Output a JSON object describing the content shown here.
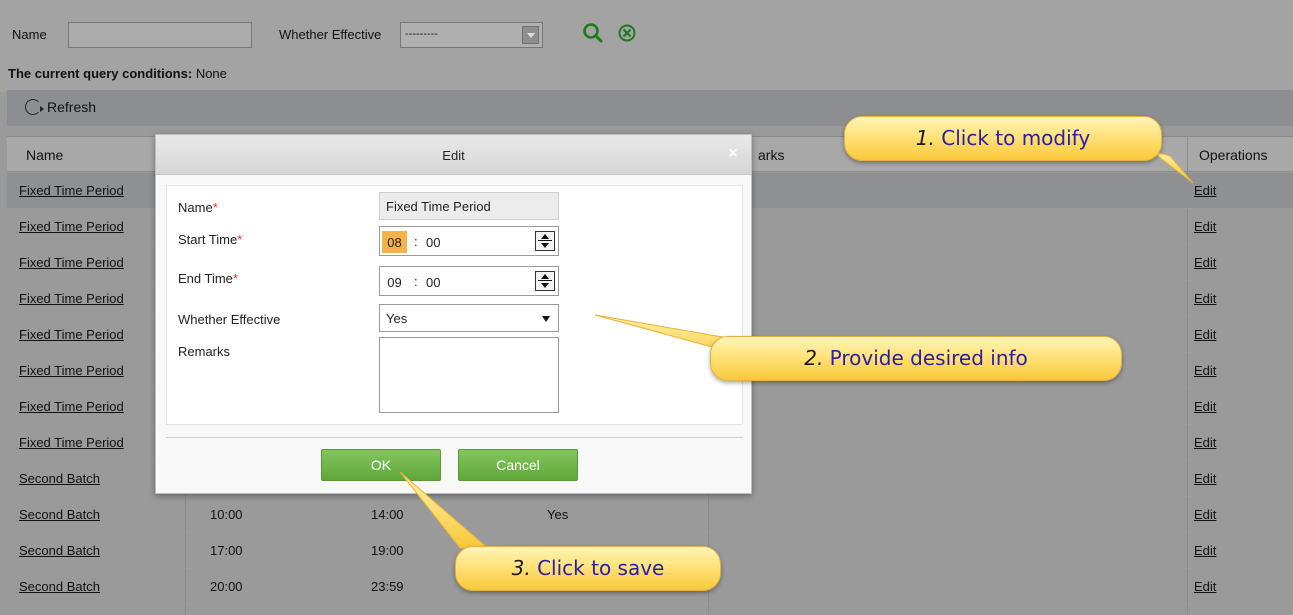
{
  "filter": {
    "name_label": "Name",
    "name_value": "",
    "effective_label": "Whether Effective",
    "effective_value": "---------",
    "query_prefix": "The current query conditions:",
    "query_value": "None"
  },
  "toolbar": {
    "refresh_label": "Refresh"
  },
  "table": {
    "headers": [
      "Name",
      "",
      "",
      "arks",
      "Operations"
    ],
    "rows": [
      {
        "name": "Fixed Time Period",
        "start": "",
        "end": "",
        "effective": "",
        "op": "Edit"
      },
      {
        "name": "Fixed Time Period",
        "start": "",
        "end": "",
        "effective": "",
        "op": "Edit"
      },
      {
        "name": "Fixed Time Period",
        "start": "",
        "end": "",
        "effective": "",
        "op": "Edit"
      },
      {
        "name": "Fixed Time Period",
        "start": "",
        "end": "",
        "effective": "",
        "op": "Edit"
      },
      {
        "name": "Fixed Time Period",
        "start": "",
        "end": "",
        "effective": "",
        "op": "Edit"
      },
      {
        "name": "Fixed Time Period",
        "start": "",
        "end": "",
        "effective": "",
        "op": "Edit"
      },
      {
        "name": "Fixed Time Period",
        "start": "",
        "end": "",
        "effective": "",
        "op": "Edit"
      },
      {
        "name": "Fixed Time Period",
        "start": "",
        "end": "",
        "effective": "",
        "op": "Edit"
      },
      {
        "name": "Second Batch",
        "start": "",
        "end": "",
        "effective": "",
        "op": "Edit"
      },
      {
        "name": "Second Batch",
        "start": "10:00",
        "end": "14:00",
        "effective": "Yes",
        "op": "Edit"
      },
      {
        "name": "Second Batch",
        "start": "17:00",
        "end": "19:00",
        "effective": "",
        "op": "Edit"
      },
      {
        "name": "Second Batch",
        "start": "20:00",
        "end": "23:59",
        "effective": "",
        "op": "Edit"
      }
    ]
  },
  "modal": {
    "title": "Edit",
    "close": "×",
    "name_label": "Name",
    "name_value": "Fixed Time Period",
    "start_label": "Start Time",
    "start_hour": "08",
    "start_minute": "00",
    "end_label": "End Time",
    "end_hour": "09",
    "end_minute": "00",
    "time_sep": ":",
    "effective_label": "Whether Effective",
    "effective_value": "Yes",
    "remarks_label": "Remarks",
    "remarks_value": "",
    "required_mark": "*",
    "ok_label": "OK",
    "cancel_label": "Cancel"
  },
  "callouts": {
    "one_num": "1.",
    "one_text": "Click to modify",
    "two_num": "2.",
    "two_text": "Provide desired info",
    "three_num": "3.",
    "three_text": "Click to save"
  },
  "icons": {
    "search": "search-icon",
    "clear": "clear-icon",
    "refresh": "refresh-icon",
    "close": "close-icon",
    "spinner": "spinner-icon",
    "dropdown": "chevron-down-icon"
  },
  "colors": {
    "accent_green": "#5fa83a",
    "callout_yellow": "#ffe27a",
    "callout_text": "#2a1ea6",
    "required_red": "#e03030",
    "active_hour": "#f4b24a"
  }
}
